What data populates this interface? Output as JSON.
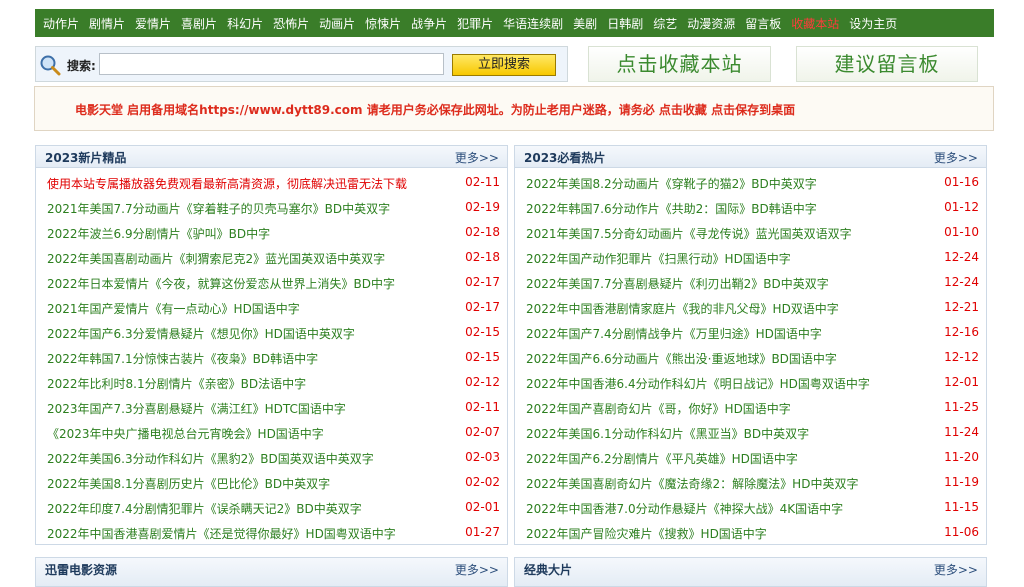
{
  "nav": {
    "items": [
      "动作片",
      "剧情片",
      "爱情片",
      "喜剧片",
      "科幻片",
      "恐怖片",
      "动画片",
      "惊悚片",
      "战争片",
      "犯罪片",
      "华语连续剧",
      "美剧",
      "日韩剧",
      "综艺",
      "动漫资源",
      "留言板",
      "收藏本站",
      "设为主页"
    ],
    "highlight_index": 16
  },
  "search": {
    "label": "搜索:",
    "value": "",
    "placeholder": "",
    "button": "立即搜索"
  },
  "actions": {
    "favorite": "点击收藏本站",
    "message_board": "建议留言板"
  },
  "notice": {
    "text": "电影天堂 启用备用域名https://www.dytt89.com 请老用户务必保存此网址。为防止老用户迷路，请务必 点击收藏 点击保存到桌面"
  },
  "panels": {
    "left": {
      "title": "2023新片精品",
      "more": "更多>>",
      "items": [
        {
          "title": "使用本站专属播放器免费观看最新高清资源，彻底解决迅雷无法下载",
          "date": "02-11",
          "red": true
        },
        {
          "title": "2021年美国7.7分动画片《穿着鞋子的贝壳马塞尔》BD中英双字",
          "date": "02-19"
        },
        {
          "title": "2022年波兰6.9分剧情片《驴叫》BD中字",
          "date": "02-18"
        },
        {
          "title": "2022年美国喜剧动画片《刺猬索尼克2》蓝光国英双语中英双字",
          "date": "02-18"
        },
        {
          "title": "2022年日本爱情片《今夜，就算这份爱恋从世界上消失》BD中字",
          "date": "02-17"
        },
        {
          "title": "2021年国产爱情片《有一点动心》HD国语中字",
          "date": "02-17"
        },
        {
          "title": "2022年国产6.3分爱情悬疑片《想见你》HD国语中英双字",
          "date": "02-15"
        },
        {
          "title": "2022年韩国7.1分惊悚古装片《夜枭》BD韩语中字",
          "date": "02-15"
        },
        {
          "title": "2022年比利时8.1分剧情片《亲密》BD法语中字",
          "date": "02-12"
        },
        {
          "title": "2023年国产7.3分喜剧悬疑片《满江红》HDTC国语中字",
          "date": "02-11"
        },
        {
          "title": "《2023年中央广播电视总台元宵晚会》HD国语中字",
          "date": "02-07"
        },
        {
          "title": "2022年美国6.3分动作科幻片《黑豹2》BD国英双语中英双字",
          "date": "02-03"
        },
        {
          "title": "2022年美国8.1分喜剧历史片《巴比伦》BD中英双字",
          "date": "02-02"
        },
        {
          "title": "2022年印度7.4分剧情犯罪片《误杀瞒天记2》BD中英双字",
          "date": "02-01"
        },
        {
          "title": "2022年中国香港喜剧爱情片《还是觉得你最好》HD国粤双语中字",
          "date": "01-27"
        }
      ]
    },
    "right": {
      "title": "2023必看热片",
      "more": "更多>>",
      "items": [
        {
          "title": "2022年美国8.2分动画片《穿靴子的猫2》BD中英双字",
          "date": "01-16"
        },
        {
          "title": "2022年韩国7.6分动作片《共助2：国际》BD韩语中字",
          "date": "01-12"
        },
        {
          "title": "2021年美国7.5分奇幻动画片《寻龙传说》蓝光国英双语双字",
          "date": "01-10"
        },
        {
          "title": "2022年国产动作犯罪片《扫黑行动》HD国语中字",
          "date": "12-24"
        },
        {
          "title": "2022年美国7.7分喜剧悬疑片《利刃出鞘2》BD中英双字",
          "date": "12-24"
        },
        {
          "title": "2022年中国香港剧情家庭片《我的非凡父母》HD双语中字",
          "date": "12-21"
        },
        {
          "title": "2022年国产7.4分剧情战争片《万里归途》HD国语中字",
          "date": "12-16"
        },
        {
          "title": "2022年国产6.6分动画片《熊出没·重返地球》BD国语中字",
          "date": "12-12"
        },
        {
          "title": "2022年中国香港6.4分动作科幻片《明日战记》HD国粤双语中字",
          "date": "12-01"
        },
        {
          "title": "2022年国产喜剧奇幻片《哥，你好》HD国语中字",
          "date": "11-25"
        },
        {
          "title": "2022年美国6.1分动作科幻片《黑亚当》BD中英双字",
          "date": "11-24"
        },
        {
          "title": "2022年国产6.2分剧情片《平凡英雄》HD国语中字",
          "date": "11-20"
        },
        {
          "title": "2022年美国喜剧奇幻片《魔法奇缘2：解除魔法》HD中英双字",
          "date": "11-19"
        },
        {
          "title": "2022年中国香港7.0分动作悬疑片《神探大战》4K国语中字",
          "date": "11-15"
        },
        {
          "title": "2022年国产冒险灾难片《搜救》HD国语中字",
          "date": "11-06"
        }
      ]
    },
    "bottom_left": {
      "title": "迅雷电影资源",
      "more": "更多>>"
    },
    "bottom_right": {
      "title": "经典大片",
      "more": "更多>>"
    }
  },
  "colors": {
    "nav_bg": "#3a7d29",
    "link_green": "#2c7f1f",
    "date_red": "#e00000",
    "notice_red": "#dd2b1c"
  }
}
